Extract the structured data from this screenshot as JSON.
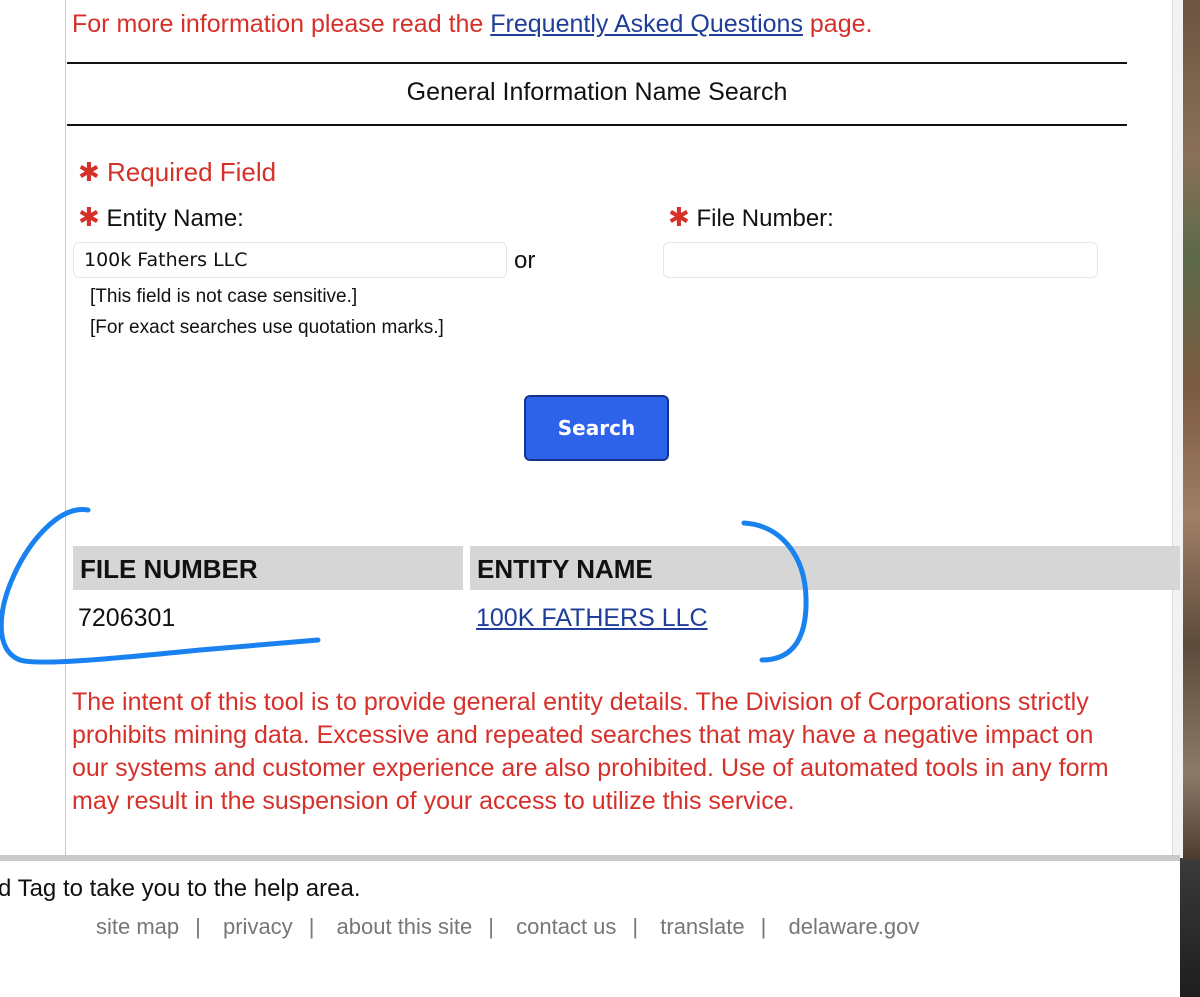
{
  "intro": {
    "prefix": "For more information please read the",
    "link": "Frequently Asked Questions",
    "suffix": "page."
  },
  "form": {
    "title": "General Information Name Search",
    "required_label": "Required Field",
    "entity_label": "Entity Name:",
    "entity_value": "100k Fathers LLC",
    "or_text": "or",
    "file_label": "File Number:",
    "file_value": "",
    "hint_case": "[This field is not case sensitive.]",
    "hint_quotes": "[For exact searches use quotation marks.]",
    "search_button": "Search"
  },
  "results": {
    "columns": [
      "FILE NUMBER",
      "ENTITY NAME"
    ],
    "rows": [
      {
        "file_number": "7206301",
        "entity_name": "100K FATHERS LLC"
      }
    ]
  },
  "notice": "The intent of this tool is to provide general entity details. The Division of Corporations strictly prohibits mining data. Excessive and repeated searches that may have a negative impact on our systems and customer experience are also prohibited. Use of automated tools in any form may result in the suspension of your access to utilize this service.",
  "help_text": "d Tag to take you to the help area.",
  "footer": {
    "links": [
      "site map",
      "privacy",
      "about this site",
      "contact us",
      "translate",
      "delaware.gov"
    ]
  },
  "colors": {
    "alert_red": "#d6302a",
    "link_blue": "#1f3e99",
    "button_blue": "#2d63e8",
    "annotation_blue": "#1a82f0"
  }
}
